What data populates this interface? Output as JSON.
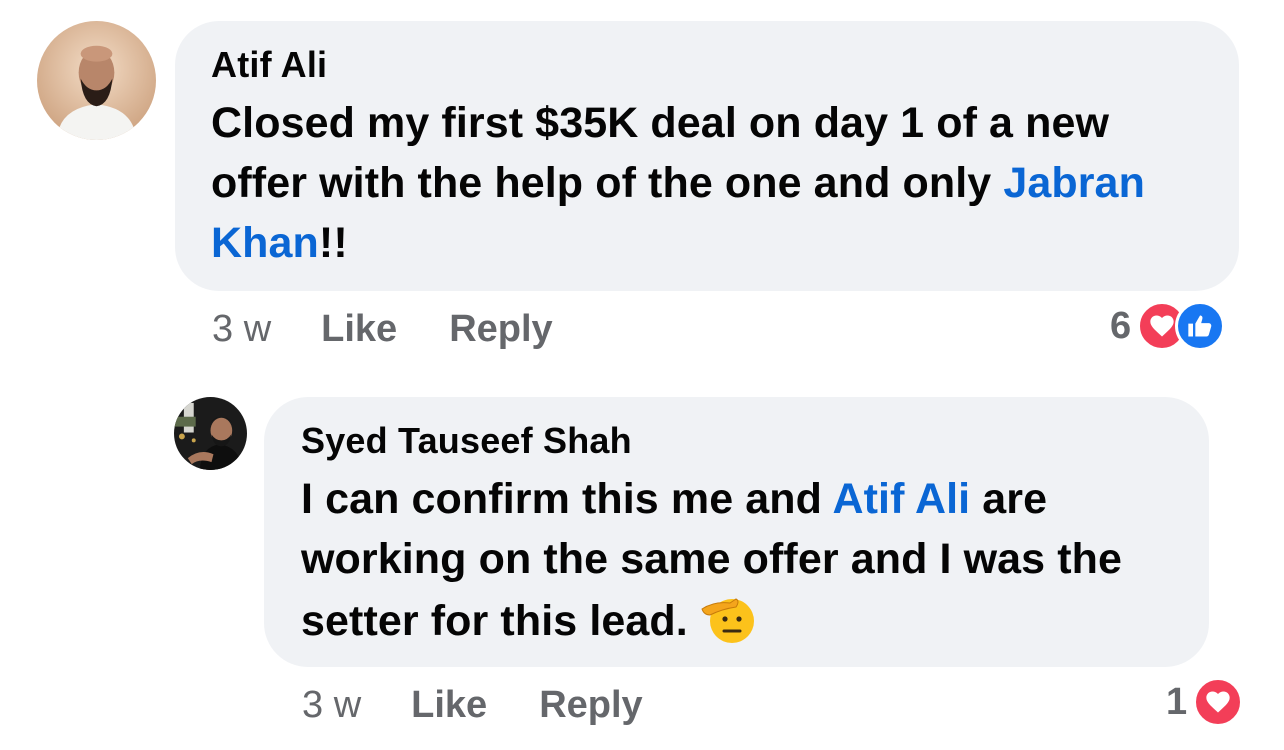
{
  "comments": [
    {
      "author": "Atif Ali",
      "text_part1": "Closed my first $35K deal on day 1 of a new offer with the help of the one and only ",
      "mention": "Jabran Khan",
      "text_part2": "!!",
      "time": "3 w",
      "like_label": "Like",
      "reply_label": "Reply",
      "reaction_count": "6",
      "reactions": [
        "love-icon",
        "like-icon"
      ]
    },
    {
      "author": "Syed Tauseef Shah",
      "text_part1": "I can confirm this me and ",
      "mention": "Atif Ali",
      "text_part2": " are working on the same offer and I was the setter for this lead.",
      "emoji": "saluting-face-emoji",
      "time": "3 w",
      "like_label": "Like",
      "reply_label": "Reply",
      "reaction_count": "1",
      "reactions": [
        "love-icon"
      ]
    }
  ],
  "colors": {
    "bubble": "#f0f2f5",
    "mention": "#0a66d4",
    "meta": "#65676b",
    "love": "#f33e58",
    "like": "#1877f2"
  }
}
